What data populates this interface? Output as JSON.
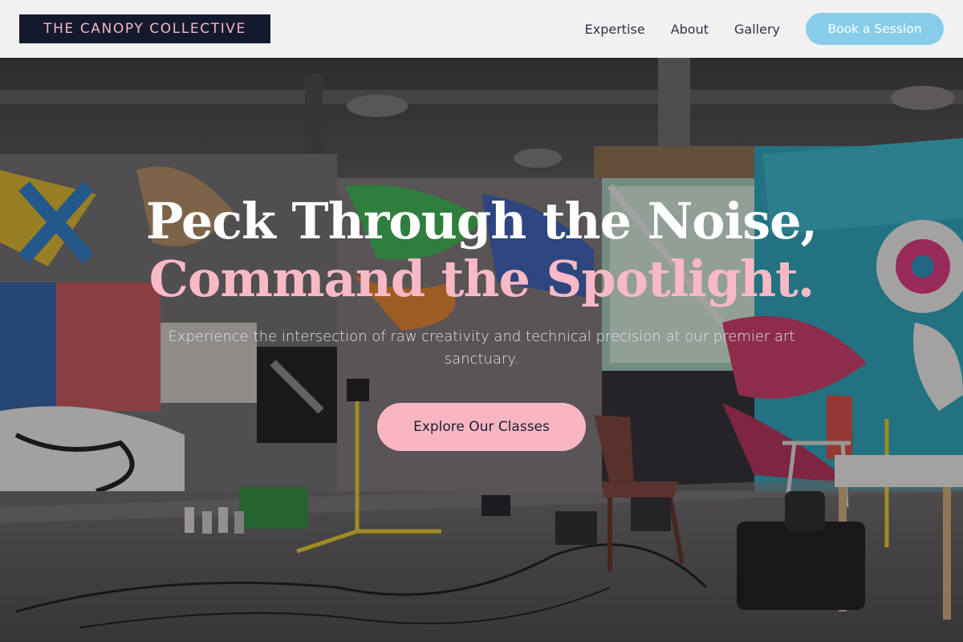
{
  "header": {
    "logo": "THE CANOPY COLLECTIVE",
    "nav": [
      "Expertise",
      "About",
      "Gallery"
    ],
    "cta": "Book a Session"
  },
  "hero": {
    "headline_line1": "Peck Through the Noise,",
    "headline_line2": "Command the Spotlight.",
    "subtitle": "Experience the intersection of raw creativity and technical precision at our premier art sanctuary.",
    "cta": "Explore Our Classes",
    "background": "graffiti-art-studio-photo"
  },
  "colors": {
    "header_bg": "#f1f1f2",
    "logo_bg": "#141a2d",
    "accent_pink": "#f8b6c3",
    "accent_blue": "#87cdea"
  }
}
